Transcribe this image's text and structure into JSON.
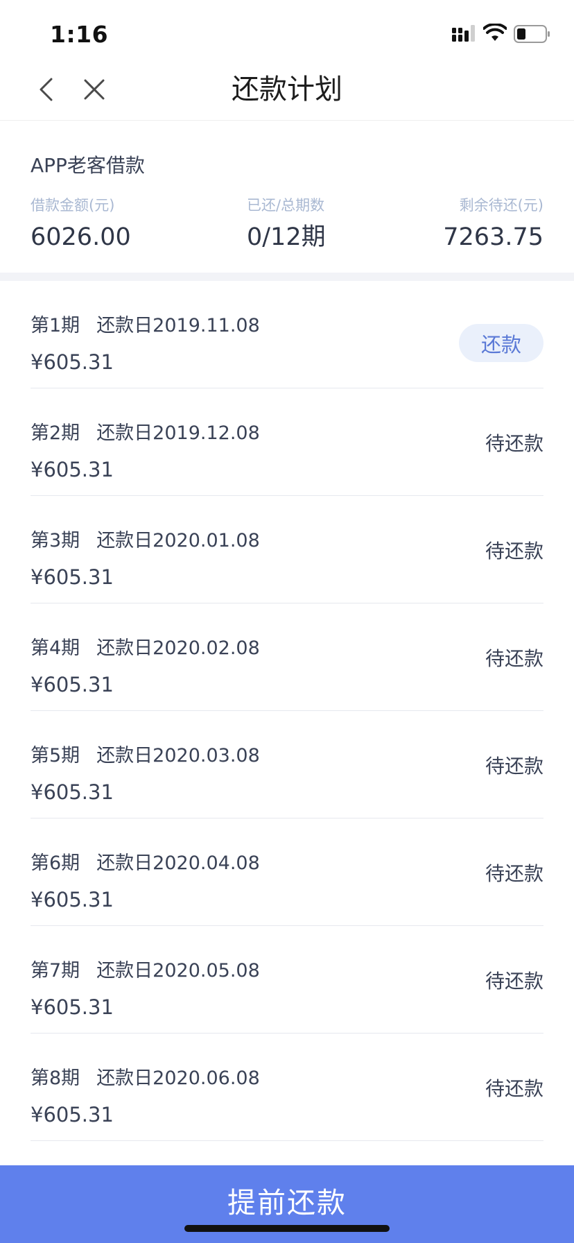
{
  "status_bar": {
    "time": "1:16"
  },
  "nav": {
    "title": "还款计划"
  },
  "summary": {
    "product_name": "APP老客借款",
    "loan_amount_label": "借款金额(元)",
    "loan_amount_value": "6026.00",
    "periods_label": "已还/总期数",
    "periods_value": "0/12期",
    "remaining_label": "剩余待还(元)",
    "remaining_value": "7263.75"
  },
  "installments": [
    {
      "period": "第1期",
      "due": "还款日2019.11.08",
      "amount": "¥605.31",
      "action": "还款"
    },
    {
      "period": "第2期",
      "due": "还款日2019.12.08",
      "amount": "¥605.31",
      "status": "待还款"
    },
    {
      "period": "第3期",
      "due": "还款日2020.01.08",
      "amount": "¥605.31",
      "status": "待还款"
    },
    {
      "period": "第4期",
      "due": "还款日2020.02.08",
      "amount": "¥605.31",
      "status": "待还款"
    },
    {
      "period": "第5期",
      "due": "还款日2020.03.08",
      "amount": "¥605.31",
      "status": "待还款"
    },
    {
      "period": "第6期",
      "due": "还款日2020.04.08",
      "amount": "¥605.31",
      "status": "待还款"
    },
    {
      "period": "第7期",
      "due": "还款日2020.05.08",
      "amount": "¥605.31",
      "status": "待还款"
    },
    {
      "period": "第8期",
      "due": "还款日2020.06.08",
      "amount": "¥605.31",
      "status": "待还款"
    }
  ],
  "footer": {
    "prepay_label": "提前还款"
  },
  "colors": {
    "accent": "#5f80ec",
    "pay_button_bg": "#eaf0fb",
    "pay_button_text": "#5a79d6",
    "label_muted": "#a9b8d2"
  }
}
